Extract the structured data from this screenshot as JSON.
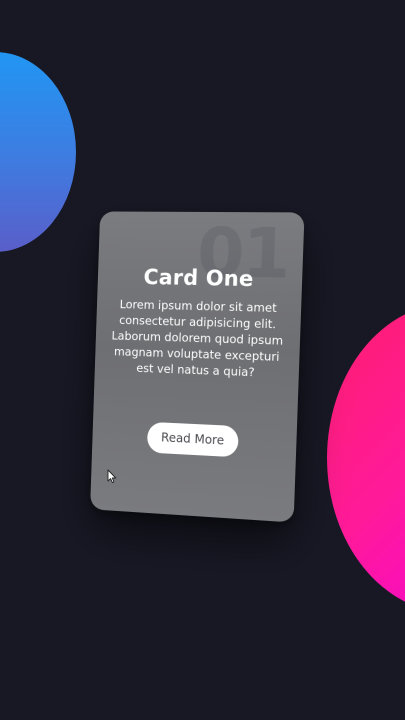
{
  "card": {
    "number": "01",
    "title": "Card One",
    "body": "Lorem ipsum dolor sit amet consectetur adipisicing elit. Laborum dolorem quod ipsum magnam voluptate excepturi est vel natus a quia?",
    "button_label": "Read More"
  },
  "colors": {
    "background": "#171824",
    "blue_circle_start": "#2196f3",
    "blue_circle_end": "#5a5ec9",
    "pink_circle_start": "#ff1e6e",
    "pink_circle_end": "#f200e6",
    "card": "#737478",
    "button": "#ffffff"
  },
  "icons": {
    "cursor": "mouse-pointer-icon"
  }
}
